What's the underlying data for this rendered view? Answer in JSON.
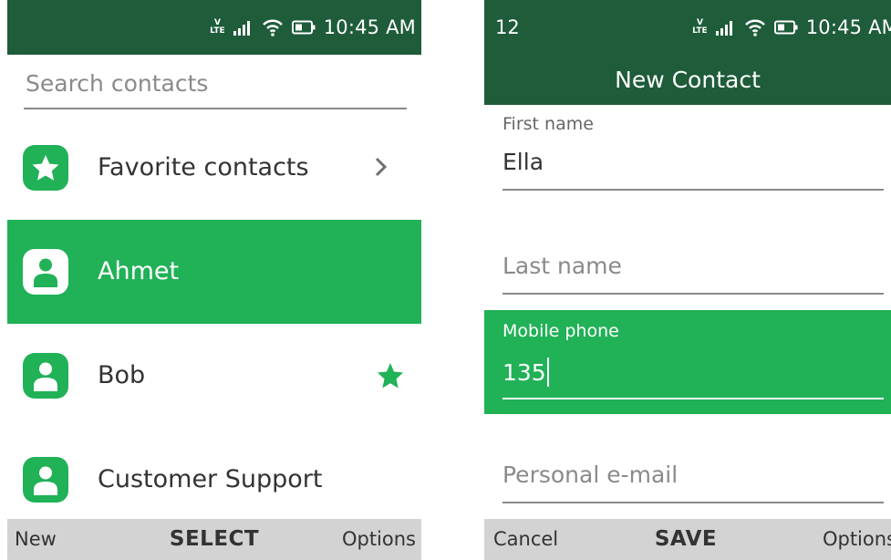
{
  "status_bar": {
    "time": "10:45 AM",
    "icons": [
      "volte-lte-icon",
      "signal-icon",
      "wifi-icon",
      "battery-icon"
    ],
    "lte_badge_top": "V",
    "lte_badge_bottom": "LTE",
    "color": "#1e5c3a"
  },
  "contacts_screen": {
    "search": {
      "placeholder": "Search contacts",
      "value": ""
    },
    "rows": [
      {
        "label": "Favorite contacts",
        "icon": "star-icon",
        "trailing": "chevron-right-icon",
        "selected": false
      },
      {
        "label": "Ahmet",
        "icon": "person-icon",
        "trailing": "",
        "selected": true
      },
      {
        "label": "Bob",
        "icon": "person-icon",
        "trailing": "favorite-star-icon",
        "selected": false
      },
      {
        "label": "Customer Support",
        "icon": "person-icon",
        "trailing": "",
        "selected": false
      }
    ],
    "softkeys": {
      "left": "New",
      "center": "SELECT",
      "right": "Options"
    }
  },
  "new_contact_screen": {
    "status_left": "12",
    "title": "New Contact",
    "fields": {
      "first_name": {
        "label": "First name",
        "value": "Ella"
      },
      "last_name": {
        "placeholder": "Last name"
      },
      "mobile_phone": {
        "label": "Mobile phone",
        "value": "135",
        "focused": true
      },
      "personal_email": {
        "placeholder": "Personal e-mail"
      }
    },
    "softkeys": {
      "left": "Cancel",
      "center": "SAVE",
      "right": "Options"
    }
  },
  "colors": {
    "accent": "#21b157",
    "header": "#1e5c3a",
    "softkey_bar": "#d3d3d3",
    "text": "#333333"
  }
}
